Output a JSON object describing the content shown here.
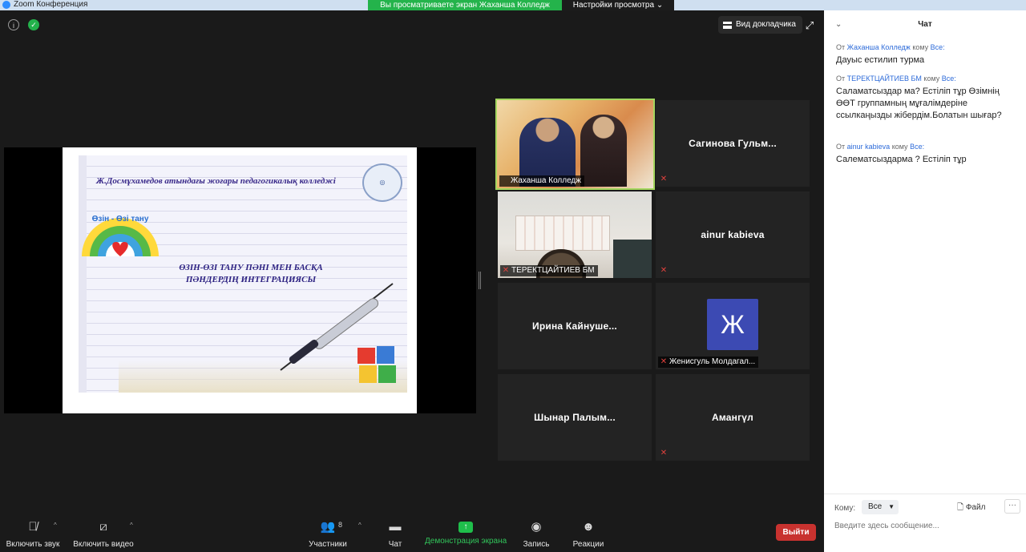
{
  "window": {
    "title": "Zoom Конференция",
    "share_banner": "Вы просматриваете экран Жаханша Колледж",
    "view_settings": "Настройки просмотра ⌄"
  },
  "main": {
    "speaker_view_label": "Вид докладчика"
  },
  "slide": {
    "college_name": "Ж.Досмұхамедов атындағы жоғары педагогикалық колледжі",
    "logo_text": "Өзін - Өзі тану",
    "subject_title_line1": "ӨЗІН-ӨЗІ ТАНУ ПӘНІ МЕН БАСҚА",
    "subject_title_line2": "ПӘНДЕРДІҢ ИНТЕГРАЦИЯСЫ"
  },
  "gallery": {
    "tiles": [
      {
        "name": "Жаханша Колледж",
        "active": true
      },
      {
        "name": "Сагинова  Гульм..."
      },
      {
        "name": "ТЕРЕКТЦАЙТИЕВ БМ"
      },
      {
        "name": "ainur kabieva"
      },
      {
        "name": "Ирина  Кайнуше..."
      },
      {
        "name": "Женисгуль Молдагал...",
        "avatar_letter": "Ж"
      },
      {
        "name": "Шынар  Палым..."
      },
      {
        "name": "Амангүл"
      }
    ]
  },
  "chat": {
    "title": "Чат",
    "messages": [
      {
        "from_prefix": "От",
        "from": "Жаханша Колледж",
        "to_prefix": "кому",
        "to": "Все:",
        "text": "Дауыс естилип турма"
      },
      {
        "from_prefix": "От",
        "from": "ТЕРЕКТЦАЙТИЕВ БМ",
        "to_prefix": "кому",
        "to": "Все:",
        "text": "Саламатсыздар ма? Естіліп тұр Өзімнің ӨӨТ группамның мұғалімдеріне ссылкаңызды жібердім.Болатын шығар?"
      },
      {
        "from_prefix": "От",
        "from": "ainur kabieva",
        "to_prefix": "кому",
        "to": "Все:",
        "text": "Салематсыздарма ? Естіліп тұр"
      }
    ],
    "to_label": "Кому:",
    "to_value": "Все",
    "file_label": "Файл",
    "more_label": "···",
    "input_placeholder": "Введите здесь сообщение..."
  },
  "toolbar": {
    "audio_label": "Включить звук",
    "video_label": "Включить видео",
    "participants_label": "Участники",
    "participants_count": "8",
    "chat_label": "Чат",
    "share_label": "Демонстрация экрана",
    "record_label": "Запись",
    "reactions_label": "Реакции",
    "leave_label": "Выйти"
  },
  "colors": {
    "accent": "#2d8cff",
    "share_green": "#24b34b",
    "leave_red": "#c8322f",
    "active_speaker": "#a4d65e"
  }
}
